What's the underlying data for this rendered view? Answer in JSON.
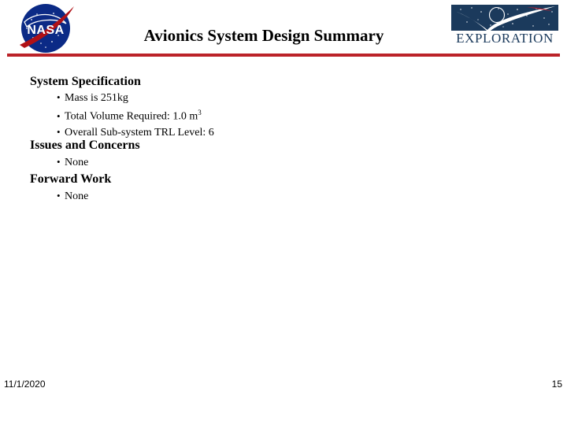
{
  "slide": {
    "title": "Avionics System Design Summary",
    "page_number": "15",
    "date": "11/1/2020",
    "rule_color": "#bb2228",
    "background_color": "#ffffff"
  },
  "logos": {
    "nasa": {
      "icon": "nasa-meatball-logo",
      "wordmark": "NASA",
      "circle_color": "#0b2a86",
      "swoosh_color": "#b01116",
      "text_color": "#ffffff"
    },
    "exploration": {
      "icon": "exploration-program-logo",
      "wordmark": "EXPLORATION",
      "panel_color": "#1b3a5c",
      "swoosh_color": "#ffffff",
      "accent_color": "#9d2235",
      "text_color": "#1b3a5c"
    }
  },
  "sections": [
    {
      "heading": "System Specification",
      "bullets": [
        {
          "glyph": "•",
          "text": "Mass is 251kg"
        },
        {
          "glyph": "•",
          "text": "Total Volume Required: 1.0 m",
          "sup": "3"
        },
        {
          "glyph": "•",
          "text": "Overall Sub-system TRL Level: 6"
        }
      ]
    },
    {
      "heading": "Issues and Concerns",
      "bullets": [
        {
          "glyph": "•",
          "text": "None"
        }
      ]
    },
    {
      "heading": "Forward Work",
      "bullets": [
        {
          "glyph": "•",
          "text": "None"
        }
      ]
    }
  ]
}
